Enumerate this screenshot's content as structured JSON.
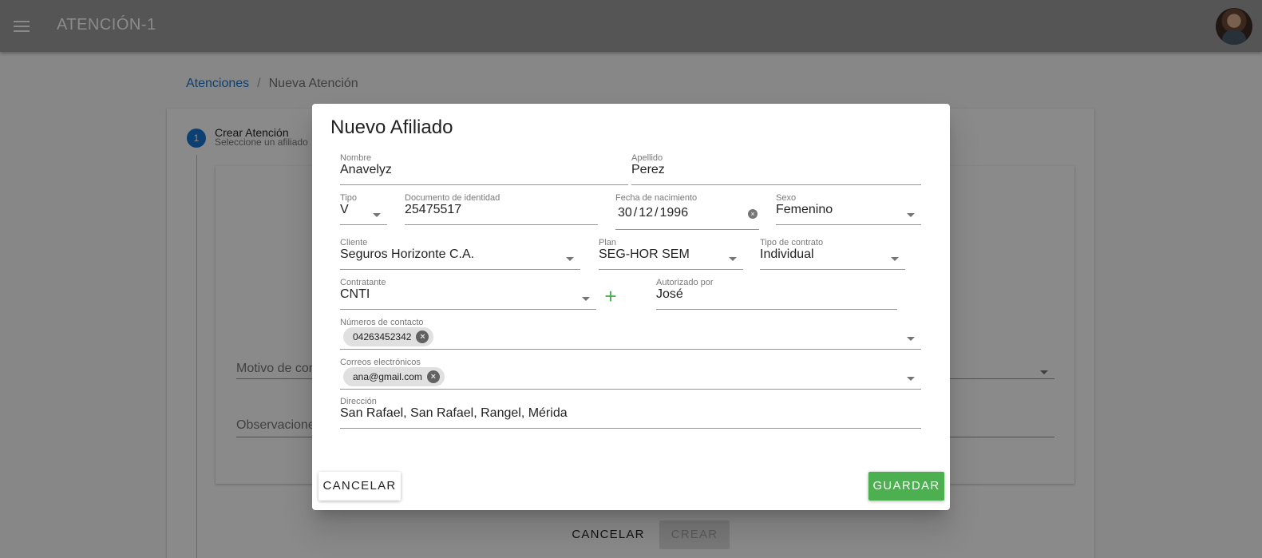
{
  "appbar": {
    "title": "ATENCIÓN-1"
  },
  "breadcrumb": {
    "link": "Atenciones",
    "separator": "/",
    "current": "Nueva Atención"
  },
  "stepper": {
    "step_number": "1",
    "step_title": "Crear Atención",
    "step_subtitle": "Seleccione un afiliado"
  },
  "background_form": {
    "motivo_label": "Motivo de cons",
    "observaciones_label": "Observaciones",
    "cancel_label": "CANCELAR",
    "create_label": "CREAR"
  },
  "dialog": {
    "title": "Nuevo Afiliado",
    "fields": {
      "nombre": {
        "label": "Nombre",
        "value": "Anavelyz"
      },
      "apellido": {
        "label": "Apellido",
        "value": "Perez"
      },
      "tipo": {
        "label": "Tipo",
        "value": "V"
      },
      "documento": {
        "label": "Documento de identidad",
        "value": "25475517"
      },
      "fecha": {
        "label": "Fecha de nacimiento",
        "day": "30",
        "month": "12",
        "year": "1996",
        "sep": "/"
      },
      "sexo": {
        "label": "Sexo",
        "value": "Femenino"
      },
      "cliente": {
        "label": "Cliente",
        "value": "Seguros Horizonte C.A."
      },
      "plan": {
        "label": "Plan",
        "value": "SEG-HOR SEM"
      },
      "tipo_contrato": {
        "label": "Tipo de contrato",
        "value": "Individual"
      },
      "contratante": {
        "label": "Contratante",
        "value": "CNTI"
      },
      "autorizado": {
        "label": "Autorizado por",
        "value": "José"
      },
      "numeros": {
        "label": "Números de contacto",
        "chips": [
          "04263452342"
        ]
      },
      "correos": {
        "label": "Correos electrónicos",
        "chips": [
          "ana@gmail.com"
        ]
      },
      "direccion": {
        "label": "Dirección",
        "value": "San Rafael, San Rafael, Rangel, Mérida"
      }
    },
    "cancel_label": "CANCELAR",
    "save_label": "GUARDAR"
  },
  "colors": {
    "primary": "#1976d2",
    "success": "#4caf50",
    "appbar": "#9e9e9e"
  },
  "icons": {
    "menu": "menu-icon",
    "add": "plus-icon",
    "clear": "clear-circle-icon",
    "chip_remove": "cancel-circle-icon",
    "dropdown": "arrow-drop-down-icon"
  }
}
